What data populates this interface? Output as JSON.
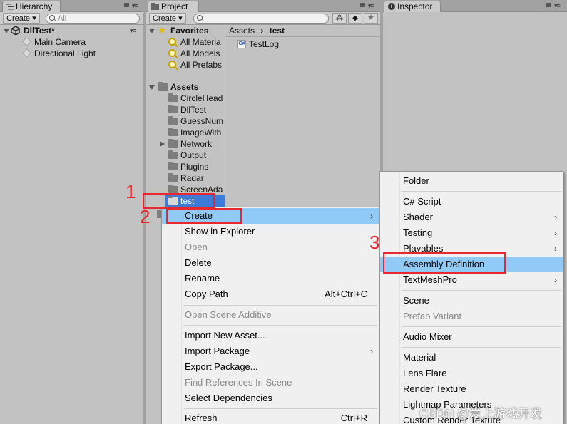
{
  "hierarchy": {
    "tab": "Hierarchy",
    "create_label": "Create",
    "search_placeholder": "All",
    "scene_name": "DllTest*",
    "items": [
      "Main Camera",
      "Directional Light"
    ]
  },
  "project": {
    "tab": "Project",
    "create_label": "Create",
    "favorites_label": "Favorites",
    "favorites": [
      "All Materia",
      "All Models",
      "All Prefabs"
    ],
    "assets_label": "Assets",
    "asset_folders": [
      "CircleHead",
      "DllTest",
      "GuessNum",
      "ImageWith",
      "Network",
      "Output",
      "Plugins",
      "Radar",
      "ScreenAda",
      "test"
    ],
    "breadcrumb_root": "Assets",
    "breadcrumb_current": "test",
    "files": [
      "TestLog"
    ],
    "file_badge": "C#"
  },
  "inspector": {
    "tab": "Inspector"
  },
  "context_menu": {
    "items": [
      {
        "label": "Create",
        "arrow": "›"
      },
      {
        "label": "Show in Explorer"
      },
      {
        "label": "Open"
      },
      {
        "label": "Delete"
      },
      {
        "label": "Rename"
      },
      {
        "label": "Copy Path",
        "shortcut": "Alt+Ctrl+C"
      },
      {
        "label": "Open Scene Additive"
      },
      {
        "label": "Import New Asset..."
      },
      {
        "label": "Import Package",
        "arrow": "›"
      },
      {
        "label": "Export Package..."
      },
      {
        "label": "Find References In Scene"
      },
      {
        "label": "Select Dependencies"
      },
      {
        "label": "Refresh",
        "shortcut": "Ctrl+R"
      }
    ]
  },
  "create_submenu": {
    "items": [
      {
        "label": "Folder"
      },
      {
        "label": "C# Script"
      },
      {
        "label": "Shader",
        "arrow": "›"
      },
      {
        "label": "Testing",
        "arrow": "›"
      },
      {
        "label": "Playables",
        "arrow": "›"
      },
      {
        "label": "Assembly Definition"
      },
      {
        "label": "TextMeshPro",
        "arrow": "›"
      },
      {
        "label": "Scene"
      },
      {
        "label": "Prefab Variant"
      },
      {
        "label": "Audio Mixer"
      },
      {
        "label": "Material"
      },
      {
        "label": "Lens Flare"
      },
      {
        "label": "Render Texture"
      },
      {
        "label": "Lightmap Parameters"
      },
      {
        "label": "Custom Render Texture"
      }
    ]
  },
  "annotations": [
    "1",
    "2",
    "3"
  ],
  "watermark": "CSDN @爱上游戏开发",
  "colors": {
    "highlight": "#91c9f7",
    "selection": "#3d7bd8",
    "annotation_red": "#e8272f"
  }
}
